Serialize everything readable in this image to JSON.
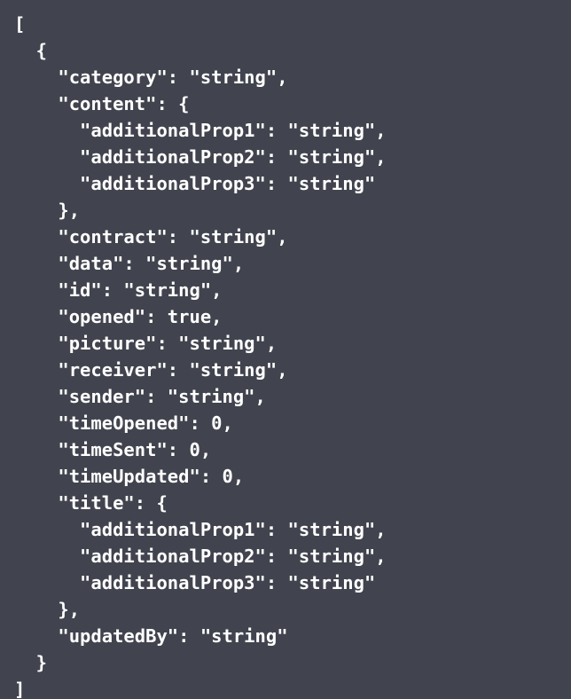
{
  "code": {
    "lines": [
      "[",
      "  {",
      "    \"category\": \"string\",",
      "    \"content\": {",
      "      \"additionalProp1\": \"string\",",
      "      \"additionalProp2\": \"string\",",
      "      \"additionalProp3\": \"string\"",
      "    },",
      "    \"contract\": \"string\",",
      "    \"data\": \"string\",",
      "    \"id\": \"string\",",
      "    \"opened\": true,",
      "    \"picture\": \"string\",",
      "    \"receiver\": \"string\",",
      "    \"sender\": \"string\",",
      "    \"timeOpened\": 0,",
      "    \"timeSent\": 0,",
      "    \"timeUpdated\": 0,",
      "    \"title\": {",
      "      \"additionalProp1\": \"string\",",
      "      \"additionalProp2\": \"string\",",
      "      \"additionalProp3\": \"string\"",
      "    },",
      "    \"updatedBy\": \"string\"",
      "  }",
      "]"
    ]
  }
}
